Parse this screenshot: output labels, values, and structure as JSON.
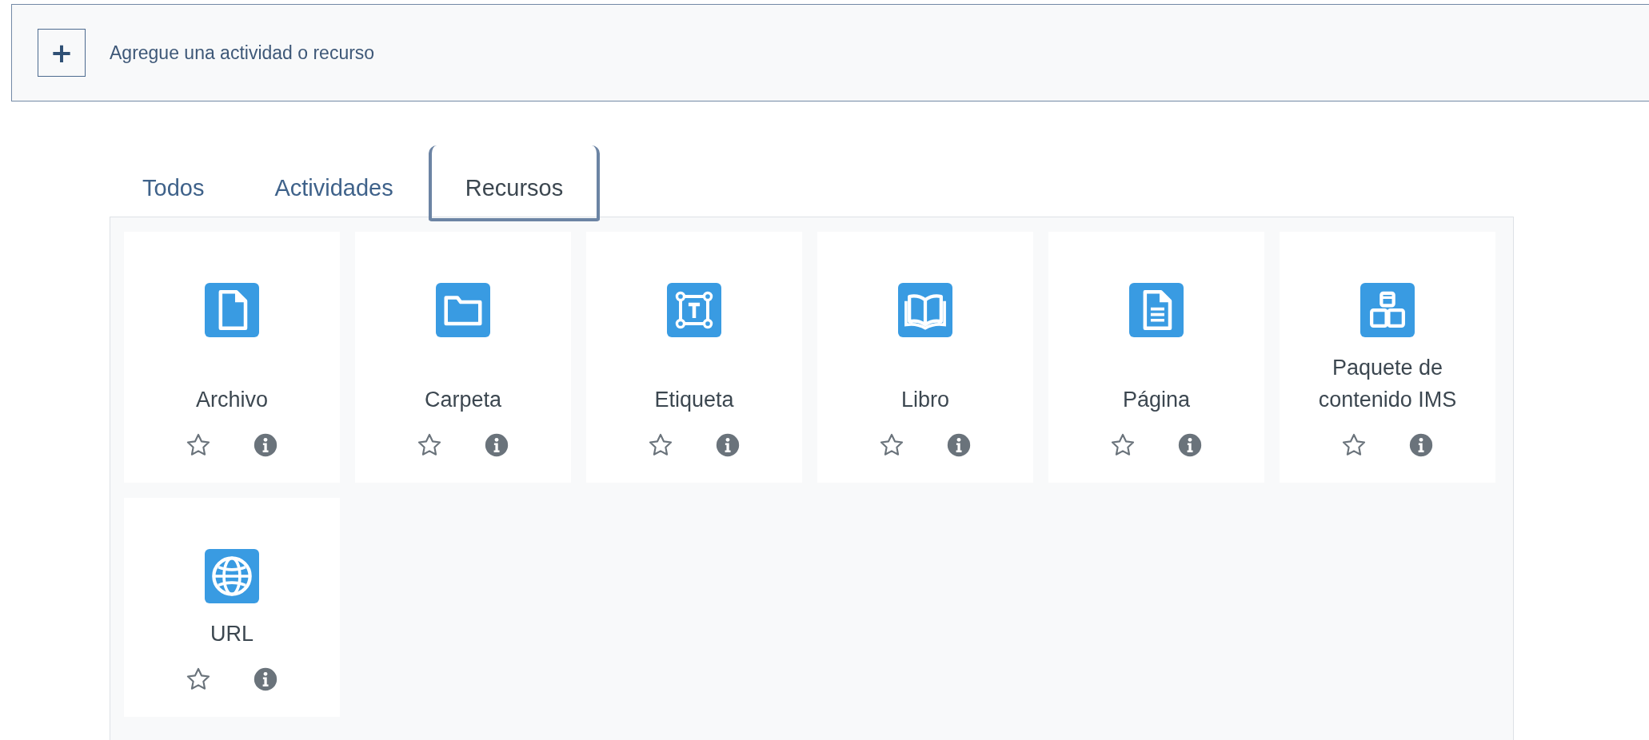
{
  "add_bar": {
    "button": "+",
    "label": "Agregue una actividad o recurso"
  },
  "tabs": [
    {
      "label": "Todos",
      "selected": false
    },
    {
      "label": "Actividades",
      "selected": false
    },
    {
      "label": "Recursos",
      "selected": true
    }
  ],
  "items": [
    {
      "name": "Archivo",
      "kind": "file",
      "starred": false
    },
    {
      "name": "Carpeta",
      "kind": "folder",
      "starred": false
    },
    {
      "name": "Etiqueta",
      "kind": "label",
      "starred": false
    },
    {
      "name": "Libro",
      "kind": "book",
      "starred": false
    },
    {
      "name": "Página",
      "kind": "page",
      "starred": false
    },
    {
      "name": "Paquete de contenido IMS",
      "kind": "package",
      "starred": false
    },
    {
      "name": "URL",
      "kind": "url",
      "starred": false
    }
  ]
}
